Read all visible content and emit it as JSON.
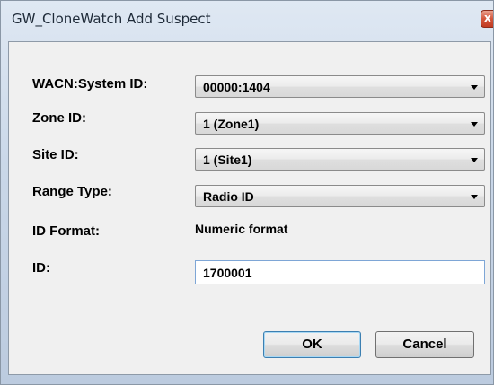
{
  "window": {
    "title": "GW_CloneWatch Add Suspect",
    "close_symbol": "x"
  },
  "form": {
    "wacn_label": "WACN:System ID:",
    "wacn_value": "00000:1404",
    "zone_label": "Zone ID:",
    "zone_value": "1 (Zone1)",
    "site_label": "Site ID:",
    "site_value": "1 (Site1)",
    "range_label": "Range Type:",
    "range_value": "Radio ID",
    "format_label": "ID Format:",
    "format_value": "Numeric format",
    "id_label": "ID:",
    "id_value": "1700001"
  },
  "buttons": {
    "ok": "OK",
    "cancel": "Cancel"
  },
  "icons": {
    "close": "close-icon",
    "dropdown": "chevron-down-icon"
  },
  "colors": {
    "title_gradient_top": "#dfe8f3",
    "client_background": "#f0f0f0",
    "close_red": "#c23b22",
    "focus_border": "#7ea6d6"
  }
}
